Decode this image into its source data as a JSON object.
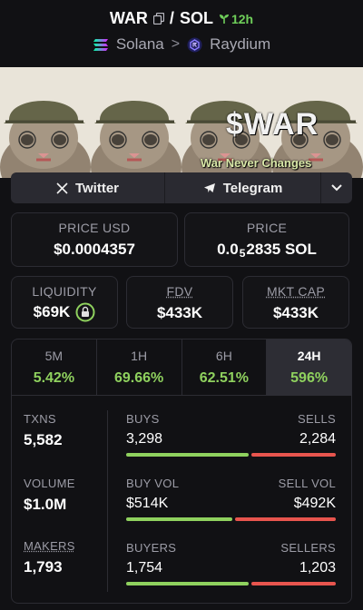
{
  "header": {
    "base_symbol": "WAR",
    "separator": "/",
    "quote_symbol": "SOL",
    "age": "12h",
    "chain": "Solana",
    "chevron": ">",
    "dex": "Raydium"
  },
  "banner": {
    "title": "$WAR",
    "subtitle": "War Never Changes"
  },
  "socials": {
    "twitter_label": "Twitter",
    "telegram_label": "Telegram"
  },
  "prices": {
    "usd_label": "PRICE USD",
    "usd_value": "$0.0004357",
    "native_label": "PRICE",
    "native_prefix": "0.0",
    "native_zeros": "5",
    "native_digits": "2835 SOL"
  },
  "metrics": {
    "liquidity_label": "LIQUIDITY",
    "liquidity_value": "$69K",
    "fdv_label": "FDV",
    "fdv_value": "$433K",
    "mktcap_label": "MKT CAP",
    "mktcap_value": "$433K"
  },
  "tabs": [
    {
      "label": "5M",
      "value": "5.42%"
    },
    {
      "label": "1H",
      "value": "69.66%"
    },
    {
      "label": "6H",
      "value": "62.51%"
    },
    {
      "label": "24H",
      "value": "596%"
    }
  ],
  "active_tab": "24H",
  "stats": {
    "txns_label": "TXNS",
    "txns_value": "5,582",
    "volume_label": "VOLUME",
    "volume_value": "$1.0M",
    "makers_label": "MAKERS",
    "makers_value": "1,793",
    "buys_label": "BUYS",
    "buys_value": "3,298",
    "sells_label": "SELLS",
    "sells_value": "2,284",
    "buy_vol_label": "BUY VOL",
    "buy_vol_value": "$514K",
    "sell_vol_label": "SELL VOL",
    "sell_vol_value": "$492K",
    "buyers_label": "BUYERS",
    "buyers_value": "1,754",
    "sellers_label": "SELLERS",
    "sellers_value": "1,203",
    "buys_share": 0.591,
    "buy_vol_share": 0.511,
    "buyers_share": 0.593
  },
  "colors": {
    "positive": "#8fd15e",
    "negative": "#e8554e",
    "age": "#6fcf5a"
  }
}
